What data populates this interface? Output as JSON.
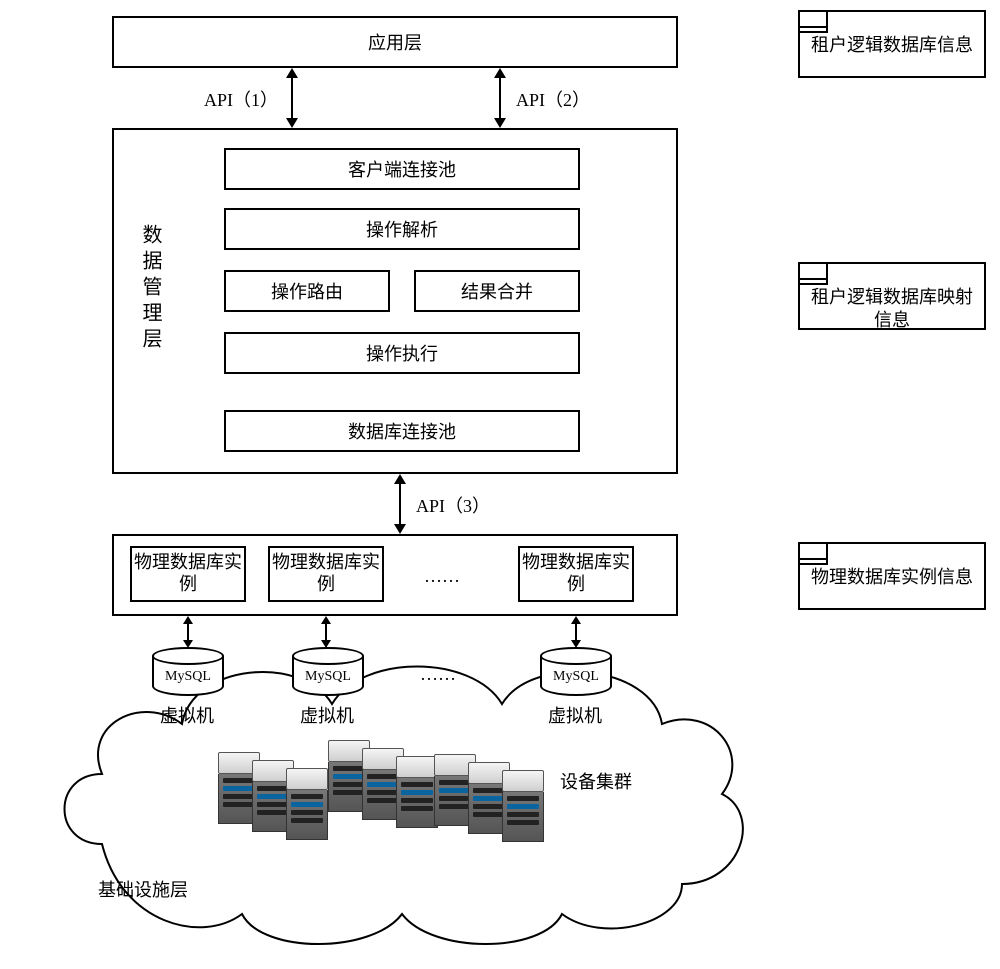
{
  "app_layer": {
    "title": "应用层"
  },
  "api": {
    "one": "API（1）",
    "two": "API（2）",
    "three": "API（3）"
  },
  "dm_layer": {
    "label": "数据管理层",
    "client_pool": "客户端连接池",
    "op_parse": "操作解析",
    "op_route": "操作路由",
    "result_merge": "结果合并",
    "op_exec": "操作执行",
    "db_pool": "数据库连接池"
  },
  "phy_layer": {
    "instance": "物理数据库实例",
    "ellipsis": "……"
  },
  "infra": {
    "db_engine": "MySQL",
    "vm": "虚拟机",
    "ellipsis": "……",
    "cluster": "设备集群",
    "label": "基础设施层"
  },
  "notes": {
    "tenant_logical_db": "租户逻辑数据库信息",
    "tenant_mapping": "租户逻辑数据库映射信息",
    "phy_instance_info": "物理数据库实例信息"
  }
}
